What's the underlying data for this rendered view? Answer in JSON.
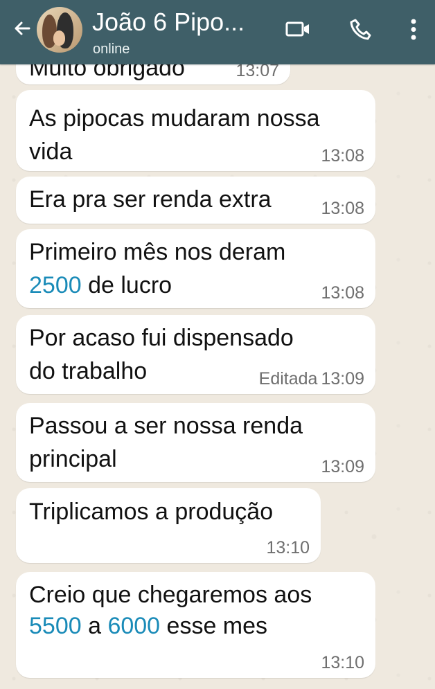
{
  "header": {
    "title": "João 6 Pipo...",
    "status": "online",
    "icons": [
      "back-arrow-icon",
      "video-call-icon",
      "phone-call-icon",
      "more-options-icon"
    ],
    "color": "#3f5f68"
  },
  "messages": [
    {
      "text_line_1": "Muito obrigado",
      "time": "13:07"
    },
    {
      "text_line_1": "As pipocas mudaram nossa",
      "text_line_2": "vida",
      "time": "13:08"
    },
    {
      "text_line_1": "Era pra ser renda extra",
      "time": "13:08"
    },
    {
      "text_line_1": "Primeiro mês nos deram",
      "text_line_2_number": "2500",
      "text_line_2_rest": " de lucro",
      "time": "13:08"
    },
    {
      "text_line_1": "Por acaso fui dispensado",
      "text_line_2": "do trabalho",
      "status": "Editada",
      "time": "13:09"
    },
    {
      "text_line_1": "Passou a ser nossa renda",
      "text_line_2": "principal",
      "time": "13:09"
    },
    {
      "text_line_1": "Triplicamos a produção",
      "time": "13:10"
    },
    {
      "text_line_1": "Creio que chegaremos aos",
      "text_line_2_number_1": "5500",
      "text_line_2_middle": " a ",
      "text_line_2_number_2": "6000",
      "text_line_2_rest": " esse mes",
      "time": "13:10"
    }
  ],
  "colors": {
    "chat_background": "#efe9df",
    "bubble": "#ffffff",
    "number": "#1a8bb8",
    "timestamp": "#6f6f6f"
  }
}
